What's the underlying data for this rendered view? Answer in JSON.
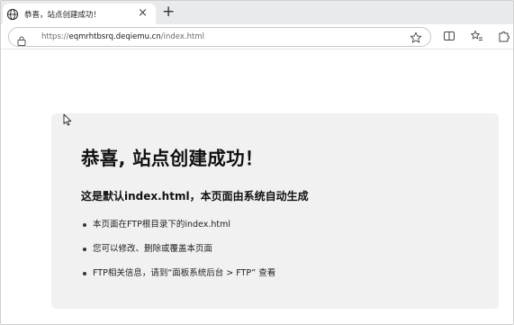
{
  "browser": {
    "tab": {
      "title": "恭喜，站点创建成功！",
      "close_glyph": "×",
      "icon": "globe-icon"
    },
    "new_tab_glyph": "+",
    "address": {
      "scheme": "https://",
      "host": "eqmrhtbsrq.deqiemu.cn",
      "path": "/index.html",
      "lock_icon": "lock-icon",
      "star_icon": "star-outline-icon"
    },
    "toolbar_icons": [
      "reading-view-icon",
      "favorites-icon",
      "extensions-icon"
    ]
  },
  "page": {
    "heading": "恭喜, 站点创建成功！",
    "subheading": "这是默认index.html，本页面由系统自动生成",
    "items": [
      "本页面在FTP根目录下的index.html",
      "您可以修改、删除或覆盖本页面",
      "FTP相关信息，请到“面板系统后台 > FTP” 查看"
    ]
  },
  "colors": {
    "card_bg": "#f1f1f1",
    "tabstrip_bg": "#e9eaec"
  }
}
